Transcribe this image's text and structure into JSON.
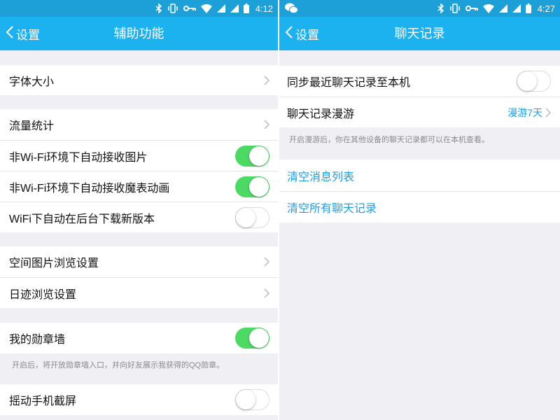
{
  "theme": {
    "status_bar": "#1d9fd7",
    "accent": "#1cb1ef",
    "toggle_on": "#4cd964",
    "link": "#1f9ee0",
    "background": "#efeff4"
  },
  "status_icons": [
    "bluetooth-icon",
    "vibrate-icon",
    "key-icon",
    "wifi-icon",
    "signal-icon",
    "signal-icon",
    "battery-icon"
  ],
  "left": {
    "status": {
      "time": "4:12"
    },
    "nav": {
      "back_label": "设置",
      "title": "辅助功能"
    },
    "rows": [
      {
        "label": "字体大小"
      },
      {
        "label": "流量统计"
      },
      {
        "label": "非Wi-Fi环境下自动接收图片",
        "on": true
      },
      {
        "label": "非Wi-Fi环境下自动接收魔表动画",
        "on": true
      },
      {
        "label": "WiFi下自动在后台下载新版本",
        "on": false
      },
      {
        "label": "空间图片浏览设置"
      },
      {
        "label": "日迹浏览设置"
      },
      {
        "label": "我的勋章墙",
        "on": true
      },
      {
        "label": "摇动手机截屏",
        "on": false
      }
    ],
    "medal_note": "开启后，将开放勋章墙入口，并向好友展示我获得的QQ勋章。"
  },
  "right": {
    "status": {
      "time": "4:27",
      "app_icon": "wechat-icon"
    },
    "nav": {
      "back_label": "设置",
      "title": "聊天记录"
    },
    "sync_row": {
      "label": "同步最近聊天记录至本机",
      "on": false
    },
    "roaming_row": {
      "label": "聊天记录漫游",
      "value": "漫游7天"
    },
    "roaming_note": "开启漫游后，你在其他设备的聊天记录都可以在本机查看。",
    "actions": [
      {
        "label": "清空消息列表"
      },
      {
        "label": "清空所有聊天记录"
      }
    ]
  }
}
